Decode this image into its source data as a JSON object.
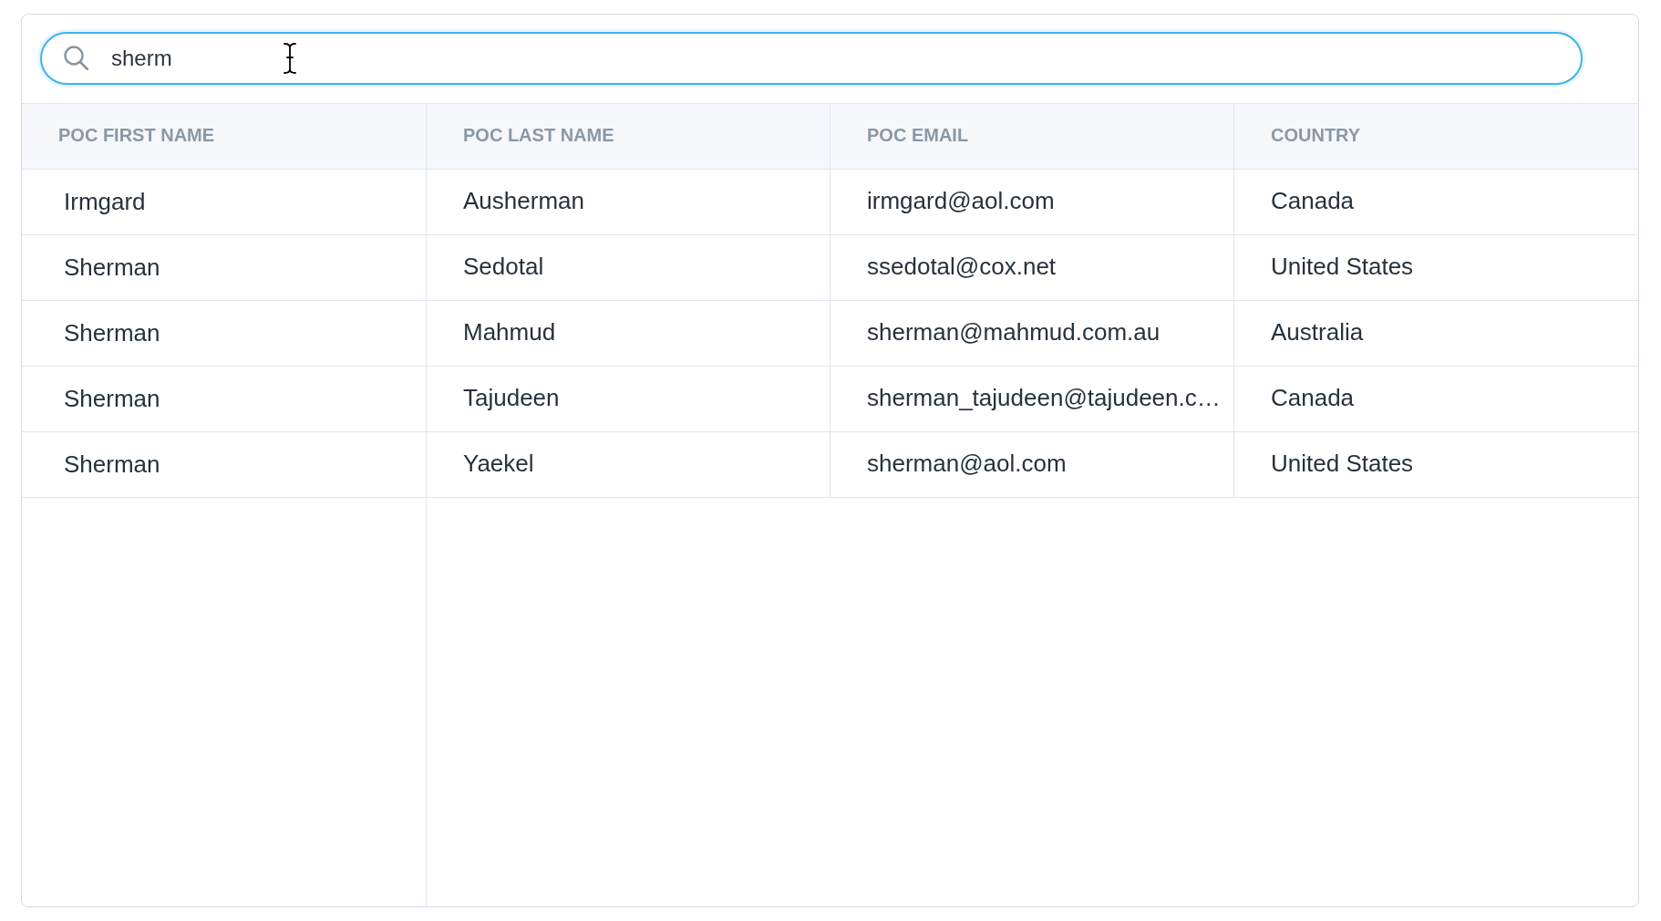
{
  "search": {
    "value": "sherm"
  },
  "table": {
    "columns": [
      "POC FIRST NAME",
      "POC LAST NAME",
      "POC EMAIL",
      "COUNTRY"
    ],
    "rows": [
      [
        "Irmgard",
        "Ausherman",
        "irmgard@aol.com",
        "Canada"
      ],
      [
        "Sherman",
        "Sedotal",
        "ssedotal@cox.net",
        "United States"
      ],
      [
        "Sherman",
        "Mahmud",
        "sherman@mahmud.com.au",
        "Australia"
      ],
      [
        "Sherman",
        "Tajudeen",
        "sherman_tajudeen@tajudeen.c…",
        "Canada"
      ],
      [
        "Sherman",
        "Yaekel",
        "sherman@aol.com",
        "United States"
      ]
    ]
  }
}
